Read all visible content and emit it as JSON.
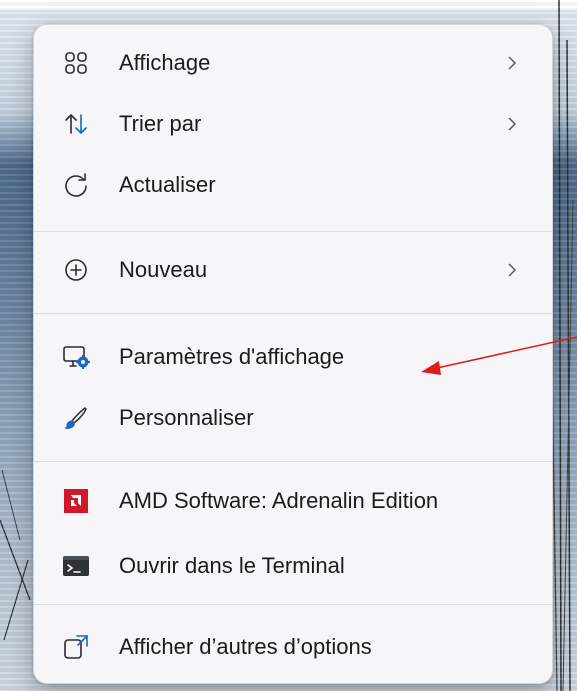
{
  "context_menu": {
    "items": [
      {
        "label": "Affichage",
        "icon": "grid-view-icon",
        "has_submenu": true
      },
      {
        "label": "Trier par",
        "icon": "sort-arrows-icon",
        "has_submenu": true
      },
      {
        "label": "Actualiser",
        "icon": "refresh-icon",
        "has_submenu": false
      },
      {
        "label": "Nouveau",
        "icon": "add-circle-icon",
        "has_submenu": true
      },
      {
        "label": "Paramètres d'affichage",
        "icon": "display-settings-icon",
        "has_submenu": false
      },
      {
        "label": "Personnaliser",
        "icon": "brush-icon",
        "has_submenu": false
      },
      {
        "label": "AMD Software: Adrenalin Edition",
        "icon": "amd-logo-icon",
        "has_submenu": false
      },
      {
        "label": "Ouvrir dans le Terminal",
        "icon": "terminal-icon",
        "has_submenu": false
      },
      {
        "label": "Afficher d’autres d’options",
        "icon": "show-more-options-icon",
        "has_submenu": false
      }
    ]
  },
  "annotation": {
    "type": "arrow",
    "color": "#e0191b",
    "points_to": "Paramètres d'affichage"
  },
  "colors": {
    "menu_bg": "#f6f6f8",
    "text": "#1b1b1b",
    "accent_blue": "#1a66c9",
    "amd_red": "#d1182b"
  }
}
